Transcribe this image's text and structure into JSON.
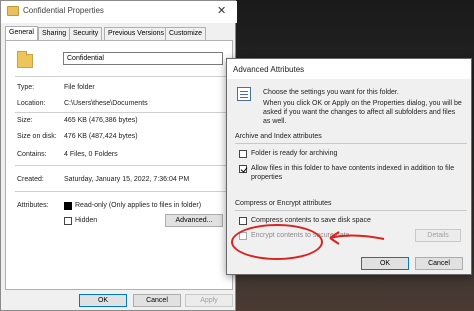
{
  "props": {
    "title": "Confidential Properties",
    "close_glyph": "✕",
    "tabs": [
      "General",
      "Sharing",
      "Security",
      "Previous Versions",
      "Customize"
    ],
    "name_value": "Confidential",
    "rows": [
      {
        "label": "Type:",
        "value": "File folder"
      },
      {
        "label": "Location:",
        "value": "C:\\Users\\these\\Documents"
      },
      {
        "label": "Size:",
        "value": "465 KB (476,386 bytes)"
      },
      {
        "label": "Size on disk:",
        "value": "476 KB (487,424 bytes)"
      },
      {
        "label": "Contains:",
        "value": "4 Files, 0 Folders"
      },
      {
        "label": "Created:",
        "value": "Saturday, January 15, 2022, 7:36:04 PM"
      }
    ],
    "attributes_label": "Attributes:",
    "readonly_label": "Read-only (Only applies to files in folder)",
    "hidden_label": "Hidden",
    "advanced_button": "Advanced...",
    "ok": "OK",
    "cancel": "Cancel",
    "apply": "Apply"
  },
  "adv": {
    "title": "Advanced Attributes",
    "intro_lines": [
      "Choose the settings you want for this folder.",
      "When you click OK or Apply on the Properties dialog, you will be",
      "asked if you want the changes to affect all subfolders and files",
      "as well."
    ],
    "group1": "Archive and Index attributes",
    "archive_label": "Folder is ready for archiving",
    "index_label_1": "Allow files in this folder to have contents indexed in addition to file",
    "index_label_2": "properties",
    "group2": "Compress or Encrypt attributes",
    "compress_label": "Compress contents to save disk space",
    "encrypt_label": "Encrypt contents to secure data",
    "details_button": "Details",
    "ok": "OK",
    "cancel": "Cancel"
  },
  "colors": {
    "annotation": "#d9241f",
    "accent": "#0078d7"
  }
}
